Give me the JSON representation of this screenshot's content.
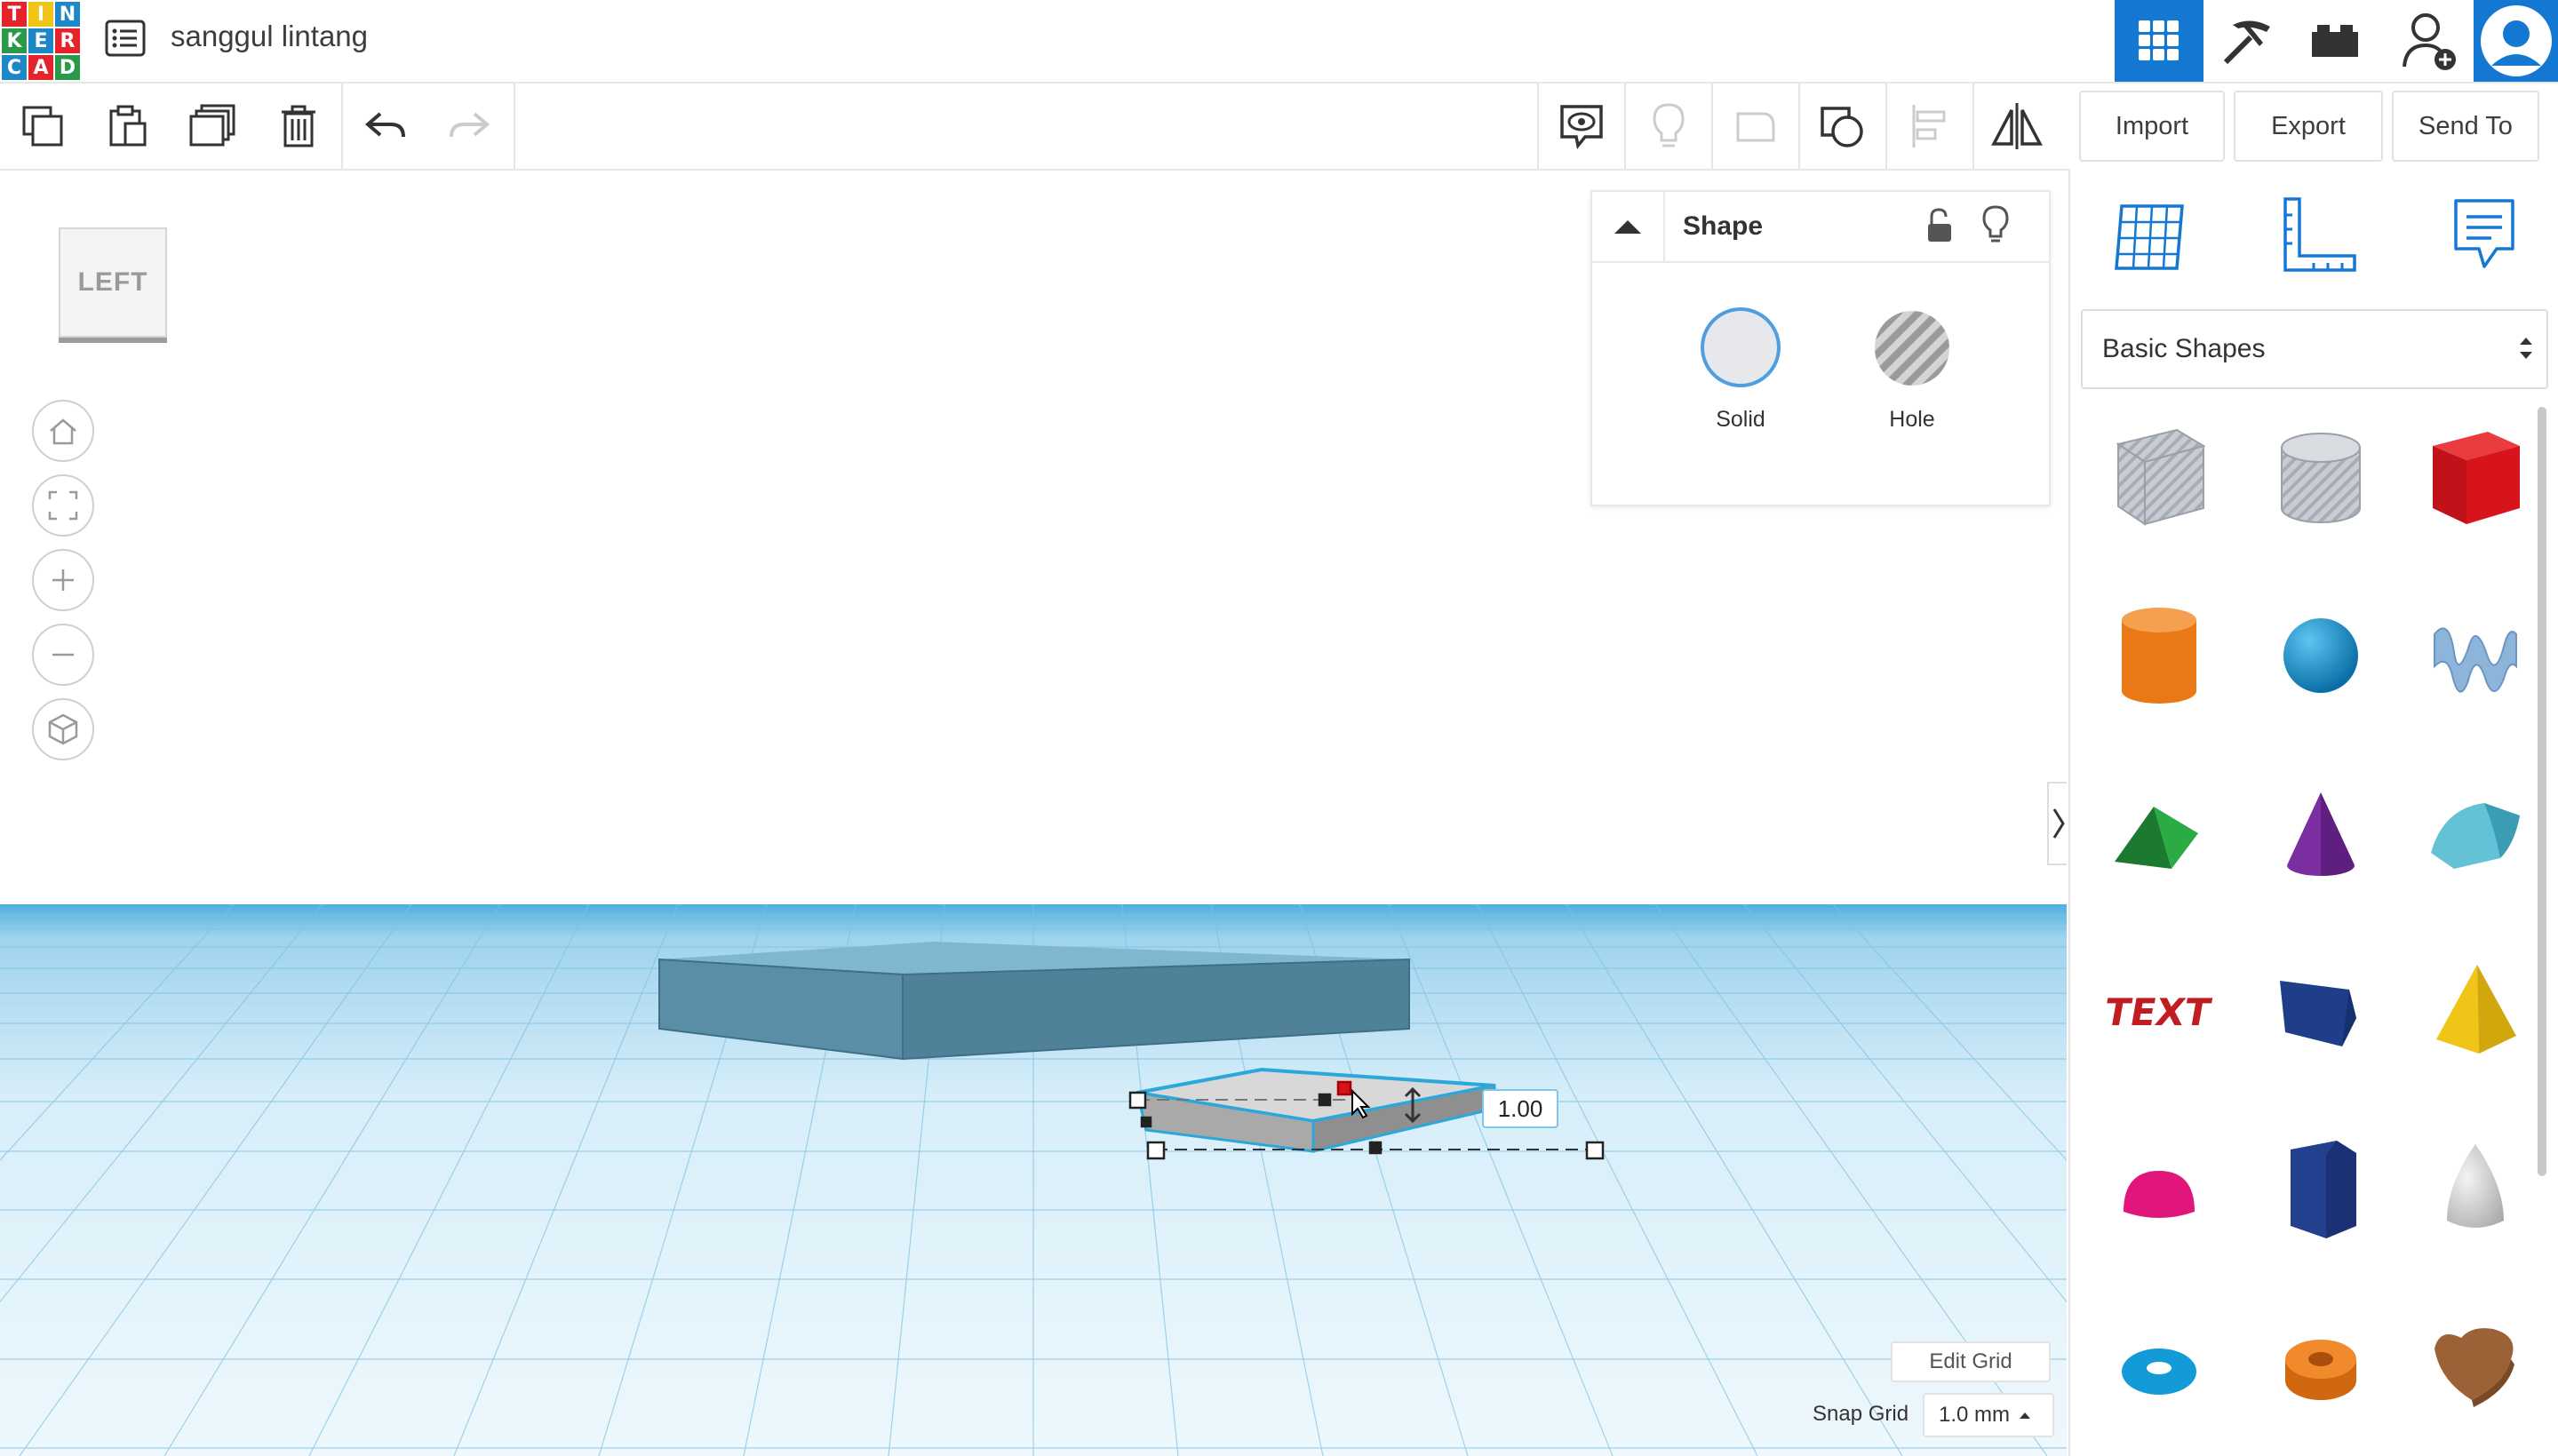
{
  "app": {
    "logo_letters": [
      "T",
      "I",
      "N",
      "K",
      "E",
      "R",
      "C",
      "A",
      "D"
    ],
    "project_title": "sanggul lintang"
  },
  "header": {
    "import_label": "Import",
    "export_label": "Export",
    "sendto_label": "Send To"
  },
  "viewcube": {
    "face_label": "LEFT"
  },
  "shape_panel": {
    "title": "Shape",
    "solid_label": "Solid",
    "hole_label": "Hole"
  },
  "dimension_input": {
    "value": "1.00"
  },
  "shapes_dropdown": {
    "selected": "Basic Shapes"
  },
  "shape_library": [
    {
      "name": "box-hole",
      "color": "#b8bcc4"
    },
    {
      "name": "cylinder-hole",
      "color": "#b8bcc4"
    },
    {
      "name": "box",
      "color": "#d7141c"
    },
    {
      "name": "cylinder",
      "color": "#e97817"
    },
    {
      "name": "sphere",
      "color": "#0d8fd0"
    },
    {
      "name": "scribble",
      "color": "#7ea8cf"
    },
    {
      "name": "roof",
      "color": "#1f9a3a"
    },
    {
      "name": "cone",
      "color": "#7a2ea0"
    },
    {
      "name": "round-roof",
      "color": "#4fb6c9"
    },
    {
      "name": "text",
      "color": "#c01c22"
    },
    {
      "name": "box-alt",
      "color": "#1f3e8a"
    },
    {
      "name": "pyramid",
      "color": "#f1c418"
    },
    {
      "name": "half-sphere",
      "color": "#e0167c"
    },
    {
      "name": "polygon",
      "color": "#1f3e8a"
    },
    {
      "name": "paraboloid",
      "color": "#d5d5d5"
    },
    {
      "name": "torus",
      "color": "#129bd6"
    },
    {
      "name": "tube",
      "color": "#e97817"
    },
    {
      "name": "heart",
      "color": "#9a6236"
    }
  ],
  "grid_controls": {
    "edit_grid_label": "Edit Grid",
    "snap_grid_label": "Snap Grid",
    "snap_grid_value": "1.0 mm"
  },
  "colors": {
    "accent": "#1477d2",
    "workplane": "#cfe8f5",
    "grid_line": "#8cc9e6",
    "selected_shape": "#bfbfbf",
    "large_box": "#5f8fa6"
  }
}
